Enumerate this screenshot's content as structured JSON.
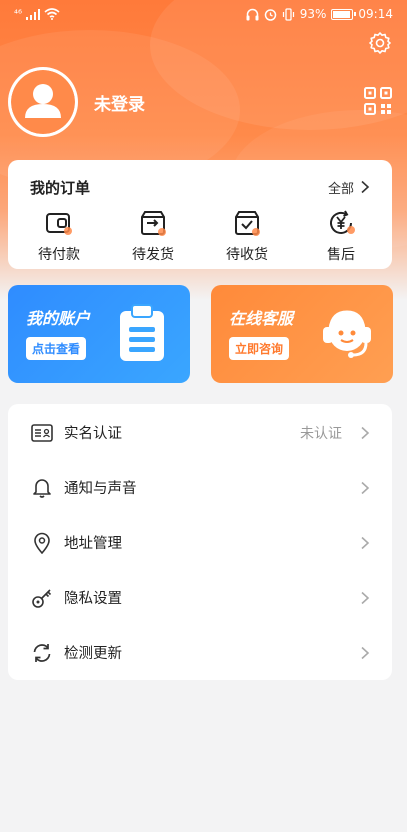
{
  "status_bar": {
    "carrier": "⁴⁶",
    "battery_percent": "93%",
    "time": "09:14"
  },
  "profile": {
    "login_text": "未登录"
  },
  "orders": {
    "title": "我的订单",
    "all_label": "全部",
    "items": [
      {
        "label": "待付款",
        "icon": "wallet-icon"
      },
      {
        "label": "待发货",
        "icon": "shipment-box-icon"
      },
      {
        "label": "待收货",
        "icon": "receive-box-icon"
      },
      {
        "label": "售后",
        "icon": "after-sale-yen-icon"
      }
    ]
  },
  "promos": {
    "account": {
      "title": "我的账户",
      "button": "点击查看",
      "icon": "clipboard-icon"
    },
    "service": {
      "title": "在线客服",
      "button": "立即咨询",
      "icon": "headset-agent-icon"
    }
  },
  "menu": {
    "items": [
      {
        "label": "实名认证",
        "value": "未认证",
        "icon": "id-card-icon"
      },
      {
        "label": "通知与声音",
        "icon": "bell-icon"
      },
      {
        "label": "地址管理",
        "icon": "location-pin-icon"
      },
      {
        "label": "隐私设置",
        "icon": "key-icon"
      },
      {
        "label": "检测更新",
        "icon": "refresh-icon"
      }
    ]
  },
  "colors": {
    "brand_orange": "#ff7a3a",
    "account_blue": "#2f8cff",
    "service_orange": "#ff8a3a",
    "text_dark": "#222222",
    "text_muted": "#999999"
  }
}
